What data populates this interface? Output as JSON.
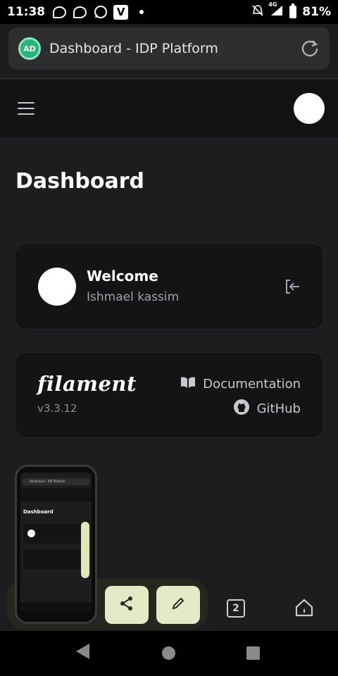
{
  "status_bar": {
    "time": "11:38",
    "battery": "81%",
    "network": "4G",
    "icons": [
      "messenger-icon",
      "messenger-icon",
      "whatsapp-icon",
      "vivaldi-icon",
      "notification-dot",
      "mute-icon",
      "signal-icon",
      "battery-icon"
    ]
  },
  "browser": {
    "site_badge": "AD",
    "url_title": "Dashboard - IDP Platform",
    "tab_count": "2"
  },
  "page": {
    "title": "Dashboard"
  },
  "welcome": {
    "heading": "Welcome",
    "user_name": "Ishmael kassim"
  },
  "filament": {
    "logo": "filament",
    "version": "v3.3.12",
    "docs_label": "Documentation",
    "github_label": "GitHub"
  },
  "thumbnail": {
    "url_title": "Dashboard - IDP Platform",
    "page_title": "Dashboard"
  },
  "colors": {
    "background": "#1d1d1f",
    "card": "#141415",
    "header": "#131314",
    "tray_button": "#e4e9c6",
    "site_badge": "#2ab27b"
  }
}
